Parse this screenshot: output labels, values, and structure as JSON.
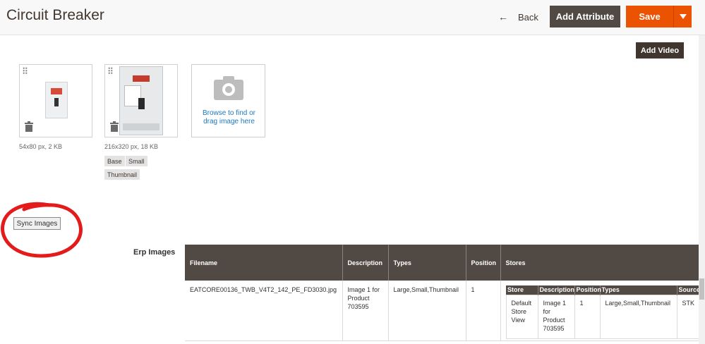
{
  "header": {
    "title": "Circuit Breaker",
    "back_label": "Back",
    "add_attribute_label": "Add Attribute",
    "save_label": "Save"
  },
  "media": {
    "add_video_label": "Add Video",
    "images": [
      {
        "meta": "54x80 px, 2 KB",
        "roles": []
      },
      {
        "meta": "216x320 px, 18 KB",
        "roles": [
          "Base",
          "Small",
          "Thumbnail"
        ]
      }
    ],
    "upload_text": "Browse to find or drag image here"
  },
  "sync": {
    "label": "Sync Images"
  },
  "erp": {
    "section_label": "Erp Images",
    "columns": [
      "Filename",
      "Description",
      "Types",
      "Position",
      "Stores"
    ],
    "rows": [
      {
        "filename": "EATCORE00136_TWB_V4T2_142_PE_FD3030.jpg",
        "description": "Image 1 for Product 703595",
        "types": "Large,Small,Thumbnail",
        "position": "1",
        "stores": {
          "columns": [
            "Store",
            "Description",
            "Position",
            "Types",
            "Source"
          ],
          "row": {
            "store": "Default Store View",
            "description": "Image 1 for Product 703595",
            "position": "1",
            "types": "Large,Small,Thumbnail",
            "source": "STK"
          }
        }
      }
    ]
  },
  "colors": {
    "accent": "#eb5202",
    "dark_button": "#514943",
    "link": "#1979c3",
    "annotation": "#e31b1b"
  }
}
